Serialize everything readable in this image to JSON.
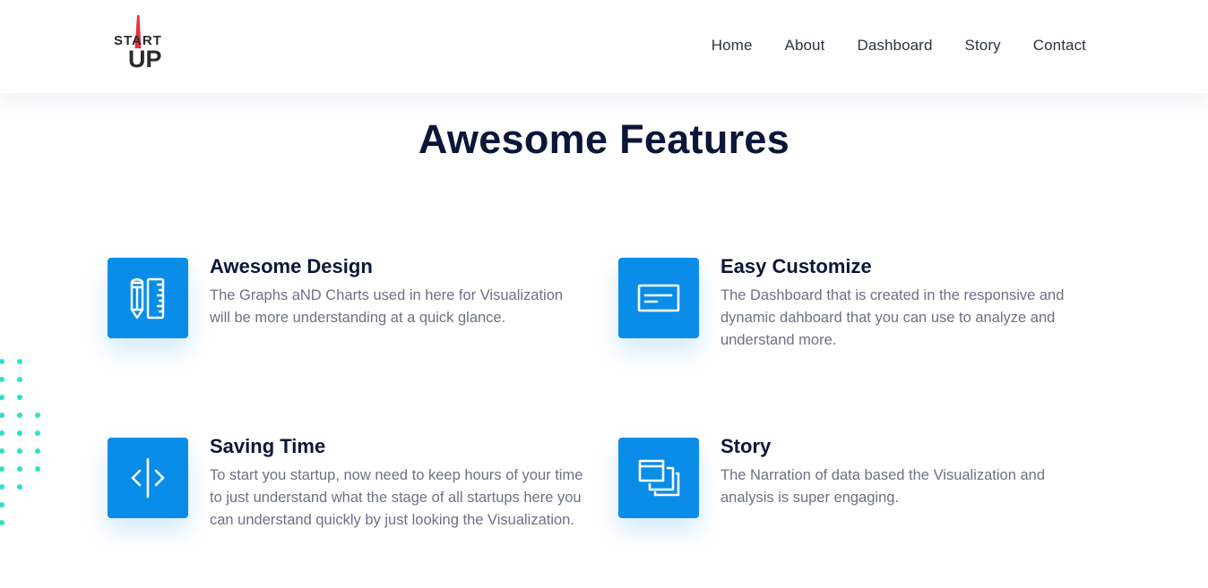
{
  "logo": {
    "text_top": "START",
    "text_bottom": "UP"
  },
  "nav": {
    "items": [
      "Home",
      "About",
      "Dashboard",
      "Story",
      "Contact"
    ]
  },
  "section": {
    "title": "Awesome Features"
  },
  "features": [
    {
      "icon": "pencil-ruler-icon",
      "title": "Awesome Design",
      "description": "The Graphs aND Charts used in here for Visualization will be more understanding at a quick glance."
    },
    {
      "icon": "window-panel-icon",
      "title": "Easy Customize",
      "description": "The Dashboard that is created in the responsive and dynamic dahboard that you can use to analyze and understand more."
    },
    {
      "icon": "code-split-icon",
      "title": "Saving Time",
      "description": "To start you startup, now need to keep hours of your time to just understand what the stage of all startups here you can understand quickly by just looking the Visualization."
    },
    {
      "icon": "stacked-windows-icon",
      "title": "Story",
      "description": "The Narration of data based the Visualization and analysis is super engaging."
    }
  ],
  "colors": {
    "accent": "#0a8de8",
    "heading": "#0c1638",
    "body_text": "#6b7285",
    "nav_text": "#2b3345",
    "dots": "#2de0c9",
    "logo_needle": "#e8313b"
  }
}
